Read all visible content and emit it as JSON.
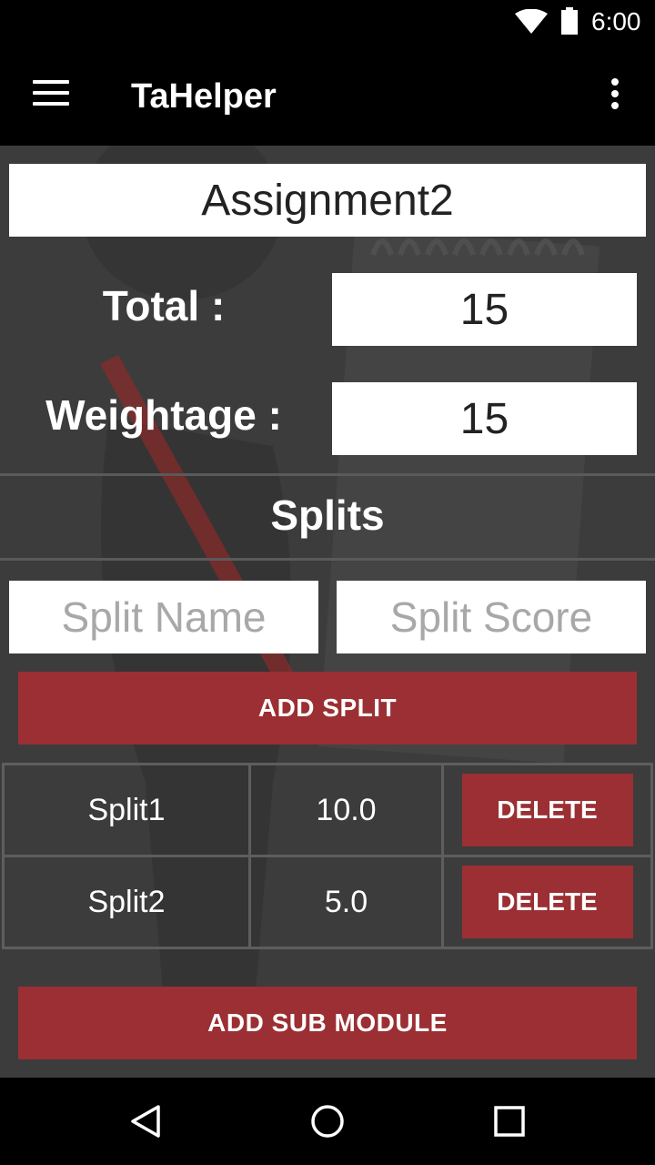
{
  "status_bar": {
    "time": "6:00"
  },
  "app_bar": {
    "title": "TaHelper"
  },
  "assignment": {
    "name": "Assignment2",
    "total_label": "Total :",
    "total_value": "15",
    "weightage_label": "Weightage :",
    "weightage_value": "15"
  },
  "splits": {
    "heading": "Splits",
    "name_placeholder": "Split Name",
    "score_placeholder": "Split Score",
    "add_button": "ADD SPLIT",
    "rows": [
      {
        "name": "Split1",
        "score": "10.0",
        "delete_label": "DELETE"
      },
      {
        "name": "Split2",
        "score": "5.0",
        "delete_label": "DELETE"
      }
    ]
  },
  "add_sub_module_button": "ADD SUB MODULE",
  "colors": {
    "accent": "#9b2f33",
    "background": "#3c3c3c",
    "bar": "#000000"
  }
}
